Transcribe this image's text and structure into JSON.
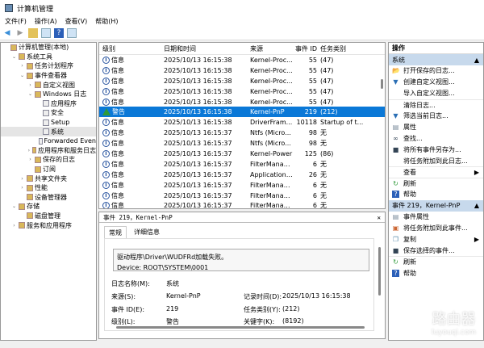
{
  "window": {
    "title": "计算机管理"
  },
  "menu": [
    "文件(F)",
    "操作(A)",
    "查看(V)",
    "帮助(H)"
  ],
  "tree": [
    {
      "label": "计算机管理(本地)",
      "level": 0,
      "exp": ""
    },
    {
      "label": "系统工具",
      "level": 1,
      "exp": "v"
    },
    {
      "label": "任务计划程序",
      "level": 2,
      "exp": ">"
    },
    {
      "label": "事件查看器",
      "level": 2,
      "exp": "v"
    },
    {
      "label": "自定义视图",
      "level": 3,
      "exp": ">"
    },
    {
      "label": "Windows 日志",
      "level": 3,
      "exp": "v"
    },
    {
      "label": "应用程序",
      "level": 4,
      "exp": "",
      "log": true
    },
    {
      "label": "安全",
      "level": 4,
      "exp": "",
      "log": true
    },
    {
      "label": "Setup",
      "level": 4,
      "exp": "",
      "log": true
    },
    {
      "label": "系统",
      "level": 4,
      "exp": "",
      "log": true,
      "selected": true
    },
    {
      "label": "Forwarded Even",
      "level": 4,
      "exp": "",
      "log": true
    },
    {
      "label": "应用程序和服务日志",
      "level": 3,
      "exp": ">"
    },
    {
      "label": "保存的日志",
      "level": 3,
      "exp": ">"
    },
    {
      "label": "订阅",
      "level": 3,
      "exp": ""
    },
    {
      "label": "共享文件夹",
      "level": 2,
      "exp": ">"
    },
    {
      "label": "性能",
      "level": 2,
      "exp": ">"
    },
    {
      "label": "设备管理器",
      "level": 2,
      "exp": ""
    },
    {
      "label": "存储",
      "level": 1,
      "exp": "v"
    },
    {
      "label": "磁盘管理",
      "level": 2,
      "exp": ""
    },
    {
      "label": "服务和应用程序",
      "level": 1,
      "exp": ">"
    }
  ],
  "list": {
    "columns": [
      "级别",
      "日期和时间",
      "来源",
      "事件 ID",
      "任务类别"
    ],
    "rows": [
      [
        "信息",
        "2025/10/13 16:15:38",
        "Kernel-Proc...",
        "55",
        "(47)"
      ],
      [
        "信息",
        "2025/10/13 16:15:38",
        "Kernel-Proc...",
        "55",
        "(47)"
      ],
      [
        "信息",
        "2025/10/13 16:15:38",
        "Kernel-Proc...",
        "55",
        "(47)"
      ],
      [
        "信息",
        "2025/10/13 16:15:38",
        "Kernel-Proc...",
        "55",
        "(47)"
      ],
      [
        "信息",
        "2025/10/13 16:15:38",
        "Kernel-Proc...",
        "55",
        "(47)"
      ],
      [
        "警告",
        "2025/10/13 16:15:38",
        "Kernel-PnP",
        "219",
        "(212)"
      ],
      [
        "信息",
        "2025/10/13 16:15:38",
        "DriverFram...",
        "10118",
        "Startup of t..."
      ],
      [
        "信息",
        "2025/10/13 16:15:37",
        "Ntfs (Micro...",
        "98",
        "无"
      ],
      [
        "信息",
        "2025/10/13 16:15:37",
        "Ntfs (Micro...",
        "98",
        "无"
      ],
      [
        "信息",
        "2025/10/13 16:15:37",
        "Kernel-Power",
        "125",
        "(86)"
      ],
      [
        "信息",
        "2025/10/13 16:15:37",
        "FilterManag...",
        "6",
        "无"
      ],
      [
        "信息",
        "2025/10/13 16:15:37",
        "Application ...",
        "26",
        "无"
      ],
      [
        "信息",
        "2025/10/13 16:15:37",
        "FilterManag...",
        "6",
        "无"
      ],
      [
        "信息",
        "2025/10/13 16:15:37",
        "FilterManag...",
        "6",
        "无"
      ],
      [
        "信息",
        "2025/10/13 16:15:37",
        "FilterManag...",
        "6",
        "无"
      ]
    ],
    "selected_index": 5
  },
  "detail": {
    "title": "事件 219，Kernel-PnP",
    "close": "✕",
    "tabs": [
      "常规",
      "详细信息"
    ],
    "message_line1": "驱动程序\\Driver\\WUDFRd加载失败。",
    "message_line2": "Device:   ROOT\\SYSTEM\\0001",
    "log_name_label": "日志名称(M):",
    "log_name": "系统",
    "source_label": "来源(S):",
    "source": "Kernel-PnP",
    "logged_label": "记录时间(D):",
    "logged": "2025/10/13 16:15:38",
    "event_id_label": "事件 ID(E):",
    "event_id": "219",
    "task_label": "任务类别(Y):",
    "task": "(212)",
    "level_label": "级别(L):",
    "level": "警告",
    "keywords_label": "关键字(K):",
    "keywords": "(8192)"
  },
  "actions": {
    "header": "操作",
    "section1": "系统",
    "items1": [
      {
        "label": "打开保存的日志...",
        "icon": "folder-open"
      },
      {
        "label": "创建自定义视图...",
        "icon": "filter"
      },
      {
        "label": "导入自定义视图...",
        "icon": ""
      },
      {
        "label": "清除日志...",
        "icon": "",
        "sep": true
      },
      {
        "label": "筛选当前日志...",
        "icon": "filter"
      },
      {
        "label": "属性",
        "icon": "properties"
      },
      {
        "label": "查找...",
        "icon": "binoculars"
      },
      {
        "label": "将所有事件另存为...",
        "icon": "save"
      },
      {
        "label": "将任务附加到此日志...",
        "icon": ""
      },
      {
        "label": "查看",
        "icon": "",
        "sep": true,
        "sub": true
      },
      {
        "label": "刷新",
        "icon": "refresh",
        "sep": true
      },
      {
        "label": "帮助",
        "icon": "help"
      }
    ],
    "section2": "事件 219，Kernel-PnP",
    "items2": [
      {
        "label": "事件属性",
        "icon": "properties"
      },
      {
        "label": "将任务附加到此事件...",
        "icon": "task"
      },
      {
        "label": "复制",
        "icon": "copy",
        "sub": true
      },
      {
        "label": "保存选择的事件...",
        "icon": "save"
      },
      {
        "label": "刷新",
        "icon": "refresh",
        "sep": true
      },
      {
        "label": "帮助",
        "icon": "help"
      }
    ]
  },
  "watermark": {
    "text": "路由器",
    "sub": "luyouqi.com"
  },
  "colors": {
    "selection": "#0a78d7",
    "section": "#c7d9ec",
    "warning": "#2f9a3a"
  }
}
